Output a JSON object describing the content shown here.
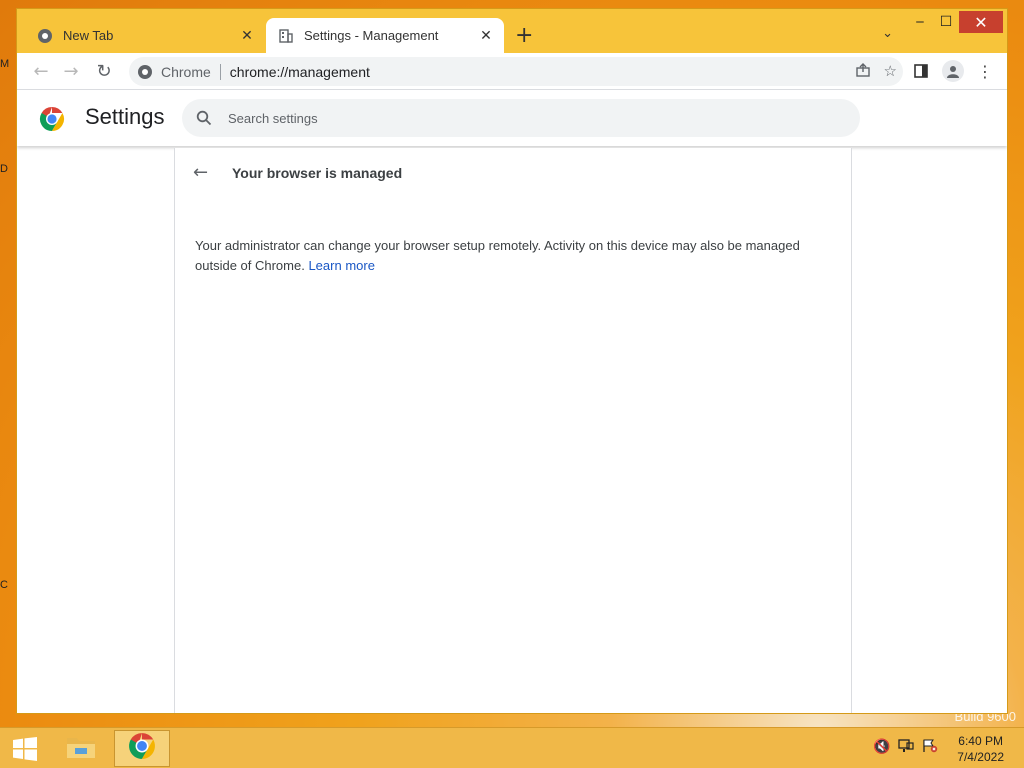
{
  "desktop": {
    "edge_glyphs": [
      "M",
      "D",
      "C"
    ],
    "build_text": "Build 9600"
  },
  "browser": {
    "tabs": [
      {
        "label": "New Tab",
        "icon": "chrome-icon",
        "active": false
      },
      {
        "label": "Settings - Management",
        "icon": "management-building-icon",
        "active": true
      }
    ],
    "new_tab_glyph": "+",
    "tab_search_glyph": "⌄",
    "window_controls": {
      "minimize": "‒",
      "maximize": "☐",
      "close": "✕"
    },
    "omnibox": {
      "site_label": "Chrome",
      "url": "chrome://management"
    },
    "nav": {
      "back": "←",
      "forward": "→",
      "reload": "↻"
    }
  },
  "settings": {
    "title": "Settings",
    "search_placeholder": "Search settings",
    "page": {
      "title": "Your browser is managed",
      "back_glyph": "←",
      "body_text": "Your administrator can change your browser setup remotely. Activity on this device may also be managed outside of Chrome. ",
      "learn_more": "Learn more"
    }
  },
  "taskbar": {
    "apps": [
      {
        "name": "file-explorer",
        "icon": "folder-icon"
      },
      {
        "name": "chrome",
        "icon": "chrome-icon",
        "active": true
      }
    ],
    "time": "6:40 PM",
    "date": "7/4/2022"
  },
  "colors": {
    "accent_link": "#1a57c5",
    "window_frame": "#f7c43a",
    "close_button": "#c7402e"
  }
}
